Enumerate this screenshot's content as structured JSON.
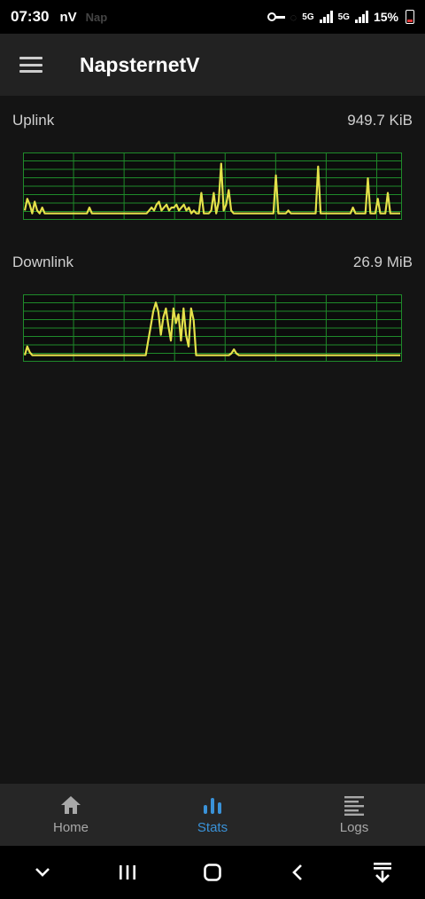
{
  "status_bar": {
    "time": "07:30",
    "app_glyph": "nV",
    "faded_text": "Nap",
    "net1": "5G",
    "net2": "5G",
    "battery": "15%"
  },
  "app_bar": {
    "title": "NapsternetV"
  },
  "uplink": {
    "label": "Uplink",
    "value": "949.7 KiB",
    "trace": [
      0.1,
      0.3,
      0.2,
      0.05,
      0.25,
      0.1,
      0.05,
      0.15,
      0.05,
      0.05,
      0.05,
      0.05,
      0.05,
      0.05,
      0.05,
      0.05,
      0.05,
      0.05,
      0.05,
      0.05,
      0.05,
      0.05,
      0.05,
      0.05,
      0.05,
      0.05,
      0.15,
      0.05,
      0.05,
      0.05,
      0.05,
      0.05,
      0.05,
      0.05,
      0.05,
      0.05,
      0.05,
      0.05,
      0.05,
      0.05,
      0.05,
      0.05,
      0.05,
      0.05,
      0.05,
      0.05,
      0.05,
      0.05,
      0.05,
      0.05,
      0.1,
      0.15,
      0.1,
      0.2,
      0.25,
      0.1,
      0.15,
      0.2,
      0.1,
      0.15,
      0.15,
      0.2,
      0.1,
      0.15,
      0.2,
      0.1,
      0.15,
      0.05,
      0.1,
      0.05,
      0.05,
      0.4,
      0.05,
      0.05,
      0.05,
      0.1,
      0.4,
      0.05,
      0.25,
      0.9,
      0.1,
      0.2,
      0.45,
      0.1,
      0.05,
      0.05,
      0.05,
      0.05,
      0.05,
      0.05,
      0.05,
      0.05,
      0.05,
      0.05,
      0.05,
      0.05,
      0.05,
      0.05,
      0.05,
      0.05,
      0.05,
      0.7,
      0.05,
      0.05,
      0.05,
      0.05,
      0.1,
      0.05,
      0.05,
      0.05,
      0.05,
      0.05,
      0.05,
      0.05,
      0.05,
      0.05,
      0.05,
      0.05,
      0.85,
      0.05,
      0.05,
      0.05,
      0.05,
      0.05,
      0.05,
      0.05,
      0.05,
      0.05,
      0.05,
      0.05,
      0.05,
      0.05,
      0.15,
      0.05,
      0.05,
      0.05,
      0.05,
      0.05,
      0.65,
      0.05,
      0.05,
      0.05,
      0.3,
      0.05,
      0.05,
      0.05,
      0.4,
      0.05,
      0.05,
      0.05,
      0.05,
      0.05
    ],
    "ymax": 1
  },
  "downlink": {
    "label": "Downlink",
    "value": "26.9 MiB",
    "trace": [
      0.05,
      0.2,
      0.1,
      0.05,
      0.05,
      0.05,
      0.05,
      0.05,
      0.05,
      0.05,
      0.05,
      0.05,
      0.05,
      0.05,
      0.05,
      0.05,
      0.05,
      0.05,
      0.05,
      0.05,
      0.05,
      0.05,
      0.05,
      0.05,
      0.05,
      0.05,
      0.05,
      0.05,
      0.05,
      0.05,
      0.05,
      0.05,
      0.05,
      0.05,
      0.05,
      0.05,
      0.05,
      0.05,
      0.05,
      0.05,
      0.05,
      0.05,
      0.05,
      0.05,
      0.05,
      0.05,
      0.05,
      0.05,
      0.05,
      0.3,
      0.55,
      0.8,
      0.95,
      0.8,
      0.4,
      0.7,
      0.85,
      0.55,
      0.3,
      0.85,
      0.6,
      0.75,
      0.3,
      0.85,
      0.4,
      0.2,
      0.85,
      0.65,
      0.05,
      0.05,
      0.05,
      0.05,
      0.05,
      0.05,
      0.05,
      0.05,
      0.05,
      0.05,
      0.05,
      0.05,
      0.05,
      0.05,
      0.08,
      0.15,
      0.08,
      0.05,
      0.05,
      0.05,
      0.05,
      0.05,
      0.05,
      0.05,
      0.05,
      0.05,
      0.05,
      0.05,
      0.05,
      0.05,
      0.05,
      0.05,
      0.05,
      0.05,
      0.05,
      0.05,
      0.05,
      0.05,
      0.05,
      0.05,
      0.05,
      0.05,
      0.05,
      0.05,
      0.05,
      0.05,
      0.05,
      0.05,
      0.05,
      0.05,
      0.05,
      0.05,
      0.05,
      0.05,
      0.05,
      0.05,
      0.05,
      0.05,
      0.05,
      0.05,
      0.05,
      0.05,
      0.05,
      0.05,
      0.05,
      0.05,
      0.05,
      0.05,
      0.05,
      0.05,
      0.05,
      0.05,
      0.05,
      0.05,
      0.05,
      0.05,
      0.05,
      0.05,
      0.05,
      0.05,
      0.05,
      0.05
    ],
    "ymax": 1
  },
  "colors": {
    "trace": "#e4e04a",
    "grid": "#1f8a2a",
    "accent": "#3a92d8"
  },
  "bottom_nav": {
    "home": "Home",
    "stats": "Stats",
    "logs": "Logs",
    "active": "stats"
  }
}
